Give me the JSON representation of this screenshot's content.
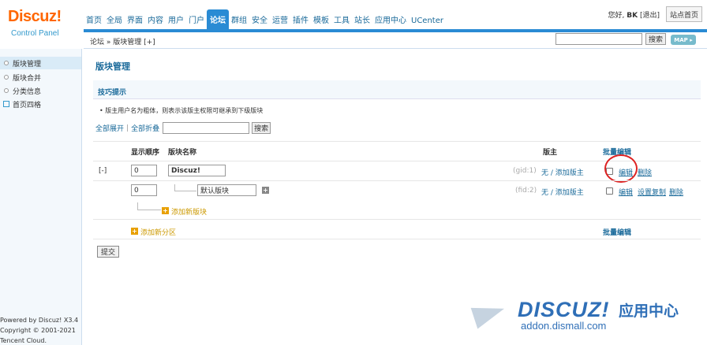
{
  "logo": {
    "brand": "Discuz!",
    "sub": "Control Panel"
  },
  "nav": [
    "首页",
    "全局",
    "界面",
    "内容",
    "用户",
    "门户",
    "论坛",
    "群组",
    "安全",
    "运营",
    "插件",
    "模板",
    "工具",
    "站长",
    "应用中心",
    "UCenter"
  ],
  "nav_active_index": 6,
  "user": {
    "greeting": "您好,",
    "name": "BK",
    "logout": "[退出]",
    "site_home": "站点首页"
  },
  "breadcrumb": "论坛 » 版块管理 [+]",
  "top_search_button": "搜索",
  "map_label": "MAP ▸",
  "sidebar": {
    "items": [
      {
        "label": "版块管理",
        "icon": "dot",
        "active": true
      },
      {
        "label": "版块合并",
        "icon": "dot",
        "active": false
      },
      {
        "label": "分类信息",
        "icon": "dot",
        "active": false
      },
      {
        "label": "首页四格",
        "icon": "external",
        "active": false
      }
    ],
    "powered": [
      "Powered by Discuz! X3.4",
      "Copyright © 2001-2021",
      "Tencent Cloud."
    ]
  },
  "main": {
    "title": "版块管理",
    "tips_title": "技巧提示",
    "tip": "版主用户名为粗体，则表示该版主权限可继承到下级版块",
    "expand_all": "全部展开",
    "collapse_all": "全部折叠",
    "search_button": "搜索",
    "headers": {
      "order": "显示顺序",
      "name": "版块名称",
      "moderator": "版主",
      "batch_edit": "批量编辑"
    },
    "rows": [
      {
        "toggle": "[-]",
        "order": "0",
        "name": "Discuz!",
        "id": "(gid:1)",
        "moderator": "无 / 添加版主",
        "actions": [
          "编辑",
          "删除"
        ]
      },
      {
        "order": "0",
        "name": "默认版块",
        "id": "(fid:2)",
        "moderator": "无 / 添加版主",
        "actions": [
          "编辑",
          "设置复制",
          "删除"
        ]
      }
    ],
    "add_forum": "添加新版块",
    "add_category": "添加新分区",
    "batch_edit_bottom": "批量编辑",
    "submit": "提交"
  },
  "watermark": {
    "brand": "DISCUZ!",
    "cn": "应用中心",
    "url": "addon.dismall.com"
  }
}
